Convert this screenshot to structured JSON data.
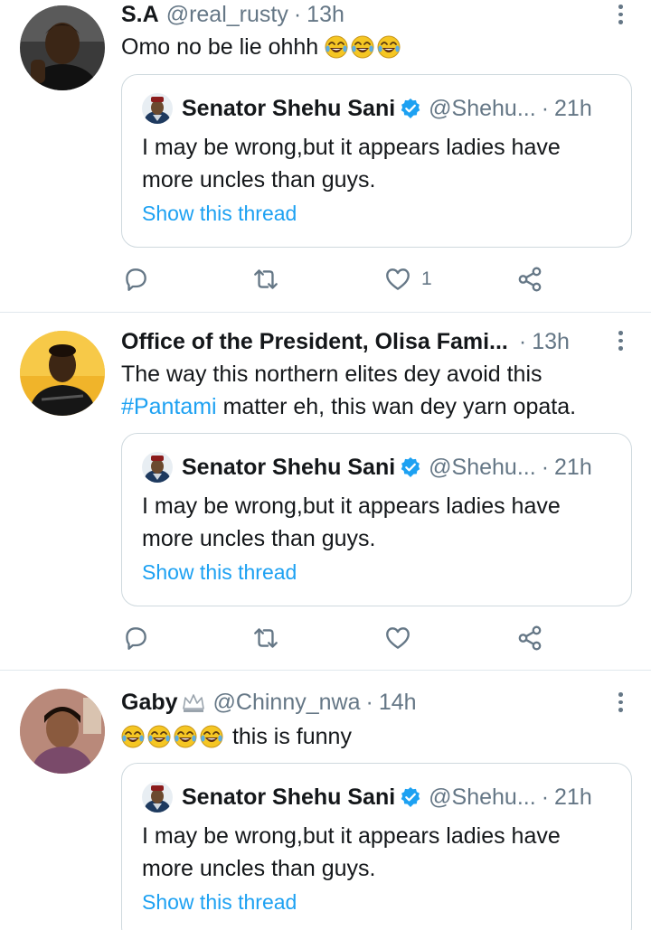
{
  "tweets": [
    {
      "name": "S.A",
      "handle": "@real_rusty",
      "separator": "·",
      "time": "13h",
      "text": "Omo no be lie ohhh",
      "emoji_icons": [
        "face-with-tears-of-joy-icon",
        "face-with-tears-of-joy-icon",
        "face-with-tears-of-joy-icon"
      ],
      "quote": {
        "name": "Senator Shehu Sani",
        "handle": "@Shehu...",
        "separator": "·",
        "time": "21h",
        "text": "I may be wrong,but it appears ladies have more uncles than guys.",
        "link": "Show this thread"
      },
      "likes": "1"
    },
    {
      "name": "Office of the President, Olisa Fami...",
      "separator": "·",
      "time": "13h",
      "text_before": "The way this northern elites dey avoid this ",
      "hashtag": "#Pantami",
      "text_after": " matter eh, this wan dey yarn opata.",
      "quote": {
        "name": "Senator Shehu Sani",
        "handle": "@Shehu...",
        "separator": "·",
        "time": "21h",
        "text": "I may be wrong,but it appears ladies have more uncles than guys.",
        "link": "Show this thread"
      }
    },
    {
      "name": "Gaby",
      "name_icon": "crown-icon",
      "handle": "@Chinny_nwa",
      "separator": "·",
      "time": "14h",
      "emoji_icons": [
        "face-with-tears-of-joy-icon",
        "face-with-tears-of-joy-icon",
        "face-with-tears-of-joy-icon",
        "face-with-tears-of-joy-icon"
      ],
      "text": "this is funny",
      "quote": {
        "name": "Senator Shehu Sani",
        "handle": "@Shehu...",
        "separator": "·",
        "time": "21h",
        "text": "I may be wrong,but it appears ladies have more uncles than guys.",
        "link": "Show this thread"
      }
    }
  ],
  "colors": {
    "text": "#14171a",
    "secondary": "#657786",
    "accent": "#1da1f2",
    "divider": "#e1e8ed",
    "quote_border": "#cfd9de",
    "verified": "#1da1f2"
  },
  "action_icons": [
    "reply-icon",
    "retweet-icon",
    "like-icon",
    "share-icon"
  ]
}
